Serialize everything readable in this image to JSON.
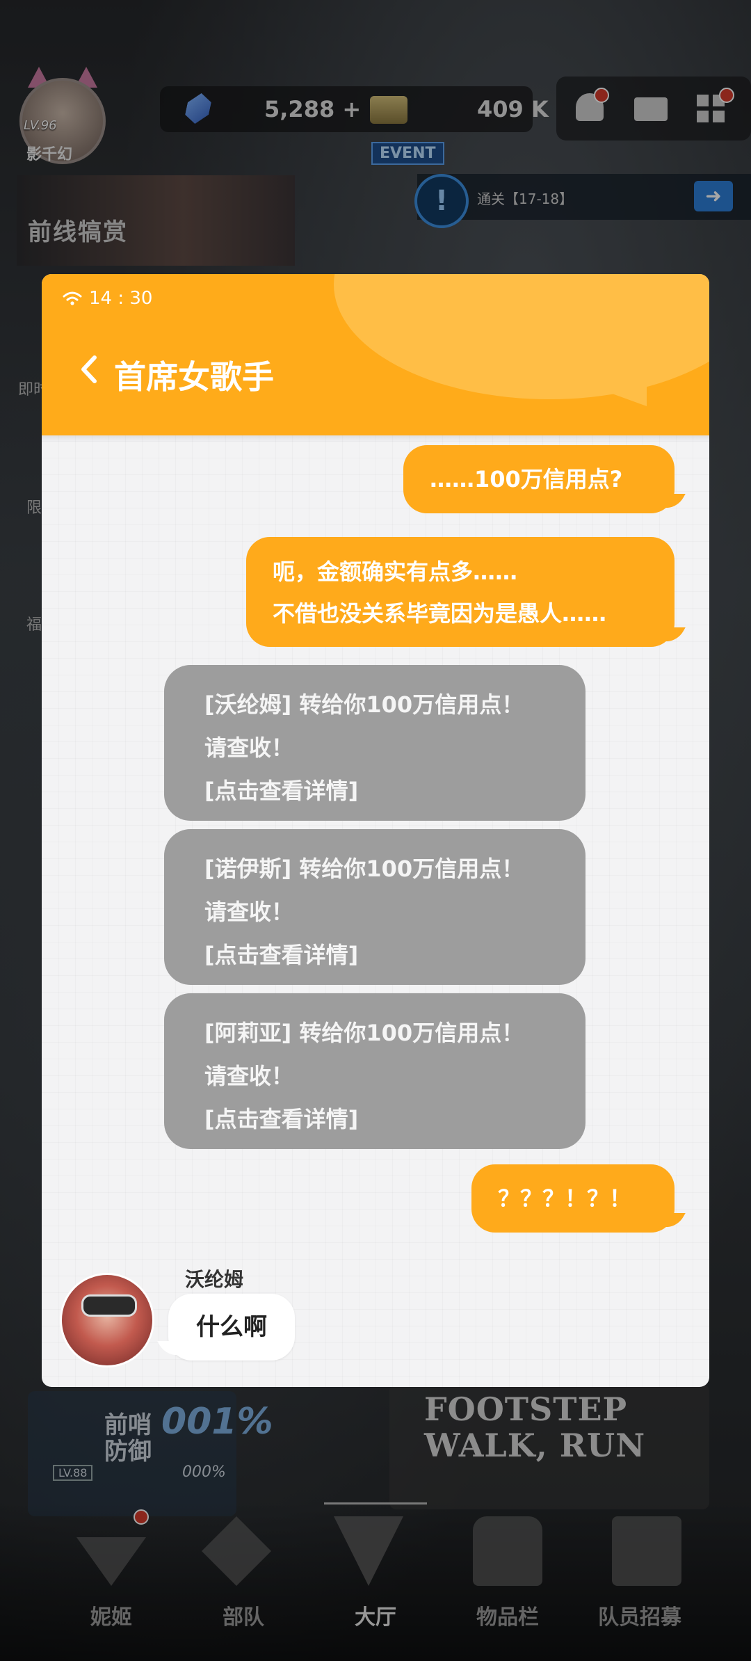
{
  "game_hud": {
    "player_level": "LV.96",
    "player_name": "影千幻",
    "gems": "5,288 +",
    "credits": "409 K",
    "event_tag": "EVENT",
    "quest_text": "通关【17-18】",
    "banner_text": "前线犒赏",
    "side_labels": [
      "即时",
      "限",
      "福"
    ],
    "bottom_card": {
      "line1": "前哨",
      "line2": "防御",
      "percent": "001%",
      "percent_small": "000%",
      "level": "LV.88"
    },
    "promo_lines": [
      "FOOTSTEP",
      "WALK, RUN"
    ]
  },
  "nav": {
    "items": [
      {
        "label": "妮姬",
        "icon": "nikke-icon"
      },
      {
        "label": "部队",
        "icon": "squad-icon"
      },
      {
        "label": "大厅",
        "icon": "lobby-icon"
      },
      {
        "label": "物品栏",
        "icon": "inventory-icon"
      },
      {
        "label": "队员招募",
        "icon": "recruit-icon"
      }
    ],
    "active_index": 2
  },
  "chat": {
    "status_time": "14 : 30",
    "title": "首席女歌手",
    "colors": {
      "accent": "#ffab1a",
      "system_card": "#9d9d9d",
      "background": "#f3f3f4"
    },
    "messages": [
      {
        "from": "me",
        "lines": [
          "……100万信用点?"
        ]
      },
      {
        "from": "me",
        "lines": [
          "呃，金额确实有点多……",
          "不借也没关系毕竟因为是愚人……"
        ]
      },
      {
        "from": "system",
        "lines": [
          "[沃纶姆] 转给你100万信用点！",
          "请查收！",
          "[点击查看详情]"
        ]
      },
      {
        "from": "system",
        "lines": [
          "[诺伊斯] 转给你100万信用点！",
          "请查收！",
          "[点击查看详情]"
        ]
      },
      {
        "from": "system",
        "lines": [
          "[阿莉亚] 转给你100万信用点！",
          "请查收！",
          "[点击查看详情]"
        ]
      },
      {
        "from": "me",
        "lines": [
          "？？？！？！"
        ]
      }
    ],
    "npc_reply": {
      "name": "沃纶姆",
      "text": "什么啊"
    }
  }
}
